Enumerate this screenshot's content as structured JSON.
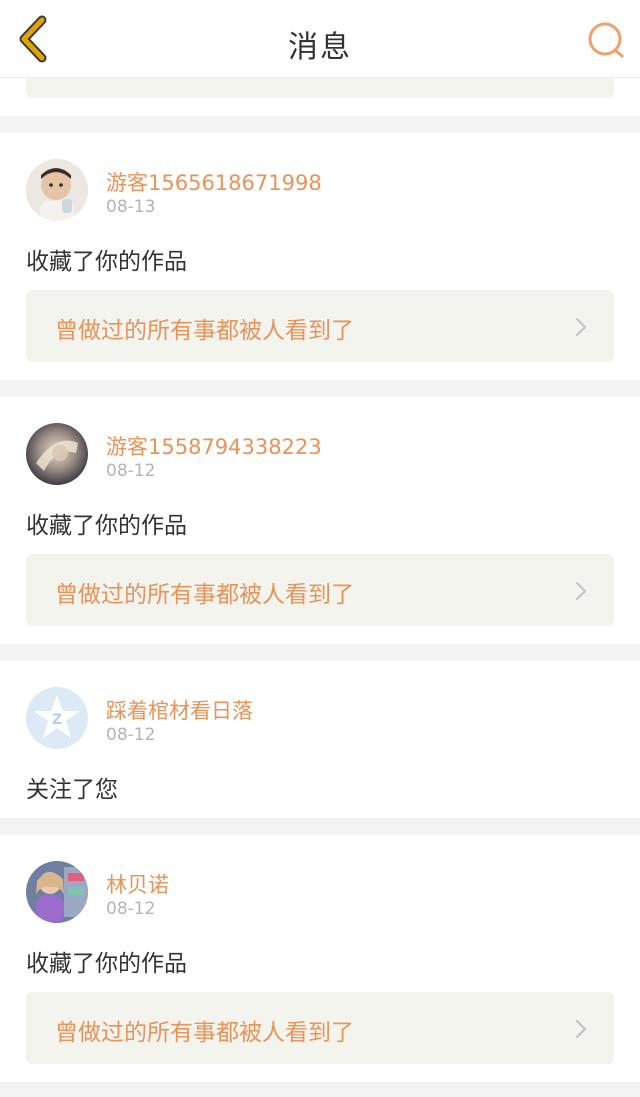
{
  "header": {
    "title": "消息"
  },
  "colors": {
    "accent": "#e8935a",
    "back_arrow": "#e0a000",
    "card_bg": "#ffffff",
    "page_bg": "#f3f3f3",
    "work_bg": "#f4f4ee"
  },
  "notifications": [
    {
      "username": "游客1565618671998",
      "date": "08-13",
      "action": "收藏了你的作品",
      "work_title": "曾做过的所有事都被人看到了"
    },
    {
      "username": "游客1558794338223",
      "date": "08-12",
      "action": "收藏了你的作品",
      "work_title": "曾做过的所有事都被人看到了"
    },
    {
      "username": "踩着棺材看日落",
      "date": "08-12",
      "action": "关注了您"
    },
    {
      "username": "林贝诺",
      "date": "08-12",
      "action": "收藏了你的作品",
      "work_title": "曾做过的所有事都被人看到了"
    }
  ],
  "icons": {
    "back": "chevron-left-icon",
    "search": "search-icon",
    "work_arrow": "chevron-right-icon"
  }
}
